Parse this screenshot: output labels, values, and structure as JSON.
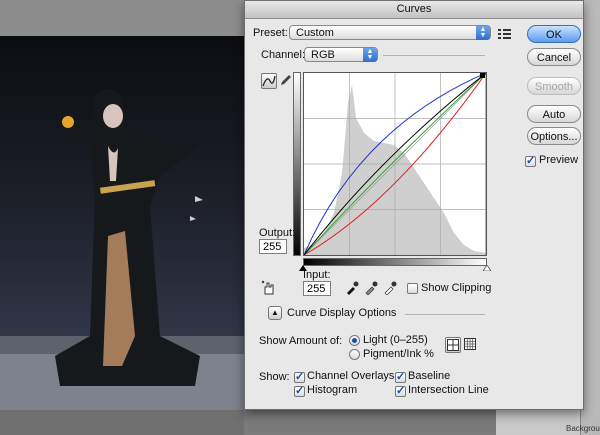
{
  "dialog": {
    "title": "Curves",
    "preset_label": "Preset:",
    "preset_value": "Custom",
    "channel_label": "Channel:",
    "channel_value": "RGB",
    "buttons": {
      "ok": "OK",
      "cancel": "Cancel",
      "smooth": "Smooth",
      "auto": "Auto",
      "options": "Options..."
    },
    "preview_label": "Preview",
    "preview_checked": true,
    "output_label": "Output:",
    "output_value": "255",
    "input_label": "Input:",
    "input_value": "255",
    "show_clipping_label": "Show Clipping",
    "curve_display_options_label": "Curve Display Options",
    "show_amount_label": "Show Amount of:",
    "light_label": "Light  (0–255)",
    "pigment_label": "Pigment/Ink %",
    "show_label": "Show:",
    "channel_overlays_label": "Channel Overlays",
    "baseline_label": "Baseline",
    "histogram_label": "Histogram",
    "intersection_line_label": "Intersection Line"
  },
  "icons": {
    "curve_tool": "curve-tool-icon",
    "pencil_tool": "pencil-icon",
    "target_adjust": "target-adjust-hand-icon",
    "eyedropper_black": "eyedropper-black-icon",
    "eyedropper_gray": "eyedropper-gray-icon",
    "eyedropper_white": "eyedropper-white-icon",
    "grid_simple": "grid-4-icon",
    "grid_detailed": "grid-10-icon",
    "preset_menu": "preset-options-icon"
  },
  "colors": {
    "curve_red": "#e02020",
    "curve_green": "#22aa22",
    "curve_blue": "#2030d0",
    "curve_composite": "#000000",
    "histogram": "#cfcfcf",
    "accent": "#3b7fe0"
  }
}
